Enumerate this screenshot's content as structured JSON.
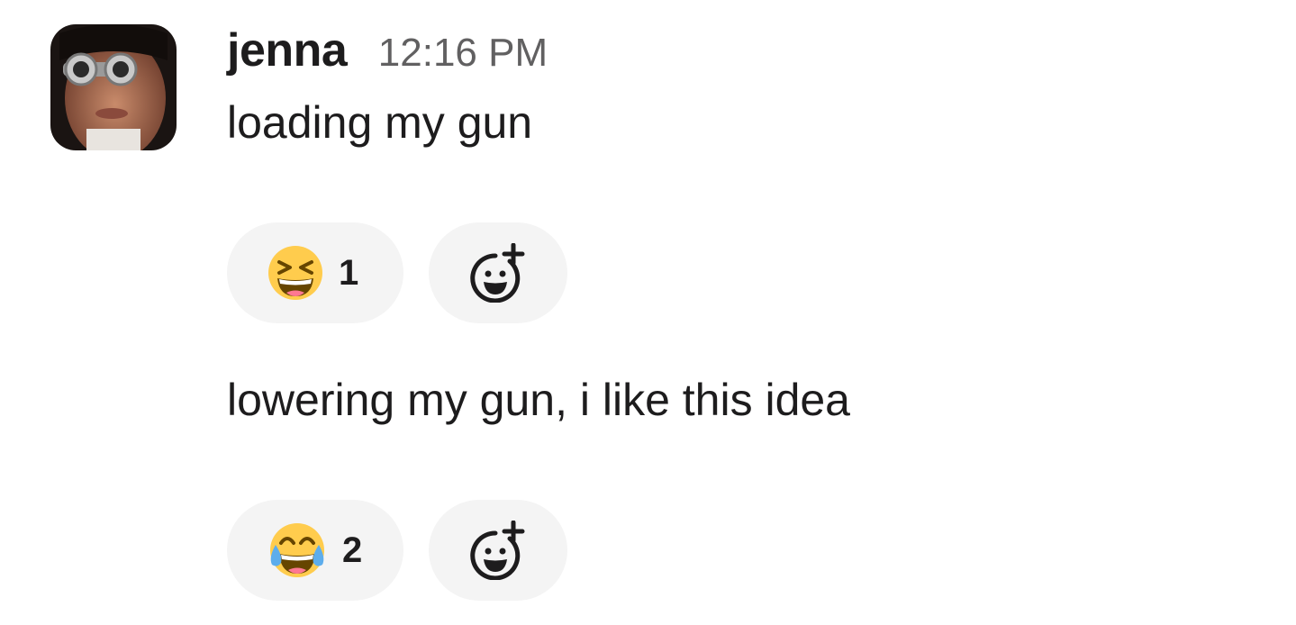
{
  "message": {
    "author": "jenna",
    "timestamp": "12:16 PM",
    "avatar_icon": "user-avatar-binoculars"
  },
  "messages": [
    {
      "text": "loading my gun",
      "reactions": [
        {
          "emoji": "laughing-squinting-face",
          "count": "1"
        }
      ],
      "add_reaction_icon": "add-reaction-icon"
    },
    {
      "text": "lowering my gun, i like this idea",
      "reactions": [
        {
          "emoji": "face-with-tears-of-joy",
          "count": "2"
        }
      ],
      "add_reaction_icon": "add-reaction-icon"
    }
  ],
  "colors": {
    "text": "#1d1c1d",
    "timestamp": "#616061",
    "pill_background": "#f4f4f4",
    "emoji_yellow": "#ffcc4d",
    "tear_blue": "#5dadec"
  }
}
